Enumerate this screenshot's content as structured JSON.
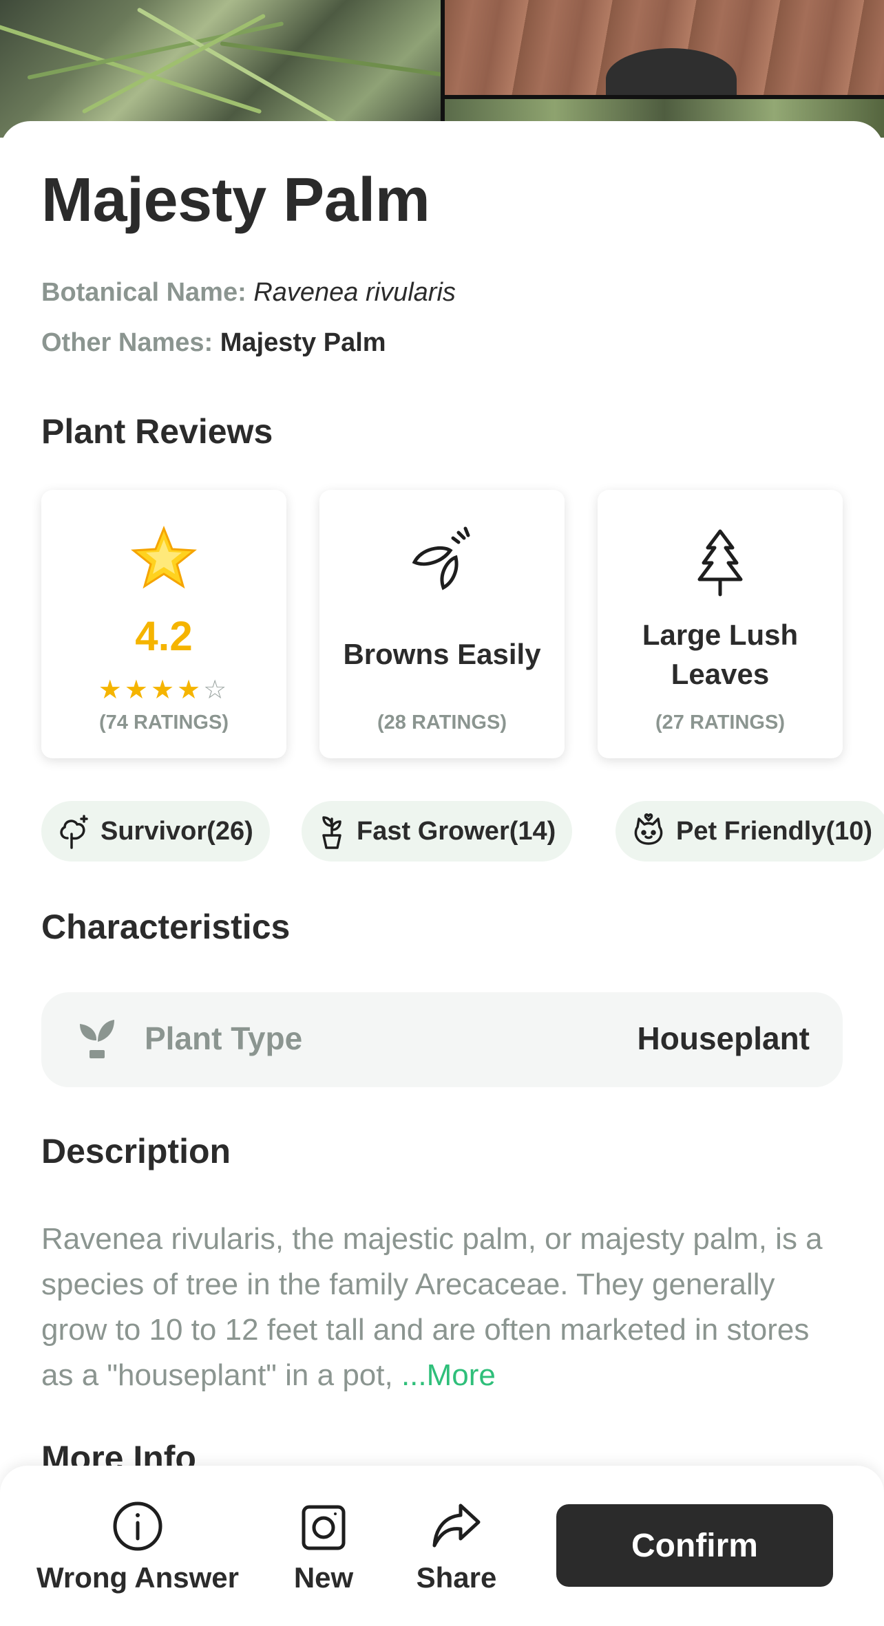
{
  "plant": {
    "name": "Majesty Palm",
    "botanical_label": "Botanical Name:",
    "botanical_value": "Ravenea rivularis",
    "other_label": "Other Names:",
    "other_value": "Majesty Palm"
  },
  "reviews": {
    "heading": "Plant Reviews",
    "rating": {
      "value": "4.2",
      "stars_filled": 4,
      "stars_total": 5,
      "count": "(74 RATINGS)",
      "icon": "glowing-star-icon"
    },
    "cards": [
      {
        "label": "Browns Easily",
        "count": "(28 RATINGS)",
        "icon": "leaves-icon"
      },
      {
        "label": "Large Lush Leaves",
        "count": "(27 RATINGS)",
        "icon": "tree-icon"
      }
    ],
    "chips": [
      {
        "label": "Survivor(26)",
        "icon": "tree-sparkle-icon"
      },
      {
        "label": "Fast Grower(14)",
        "icon": "sprout-pot-icon"
      },
      {
        "label": "Pet Friendly(10)",
        "icon": "cat-icon"
      }
    ]
  },
  "characteristics": {
    "heading": "Characteristics",
    "rows": [
      {
        "key": "Plant Type",
        "value": "Houseplant",
        "icon": "sprout-icon"
      }
    ]
  },
  "description": {
    "heading": "Description",
    "text": "Ravenea rivularis, the majestic palm, or majesty palm, is a species of tree in the family Arecaceae. They generally grow to 10 to 12 feet tall and are often marketed in stores as a \"houseplant\" in a pot, ",
    "more": "...More"
  },
  "more_info": {
    "heading": "More Info"
  },
  "bottom_bar": {
    "wrong_answer": "Wrong Answer",
    "new": "New",
    "share": "Share",
    "confirm": "Confirm"
  },
  "colors": {
    "accent_yellow": "#f5b400",
    "link_green": "#2fbf7a",
    "chip_bg": "#eef5ef",
    "muted_text": "#8b9590",
    "dark": "#2b2b2b"
  }
}
